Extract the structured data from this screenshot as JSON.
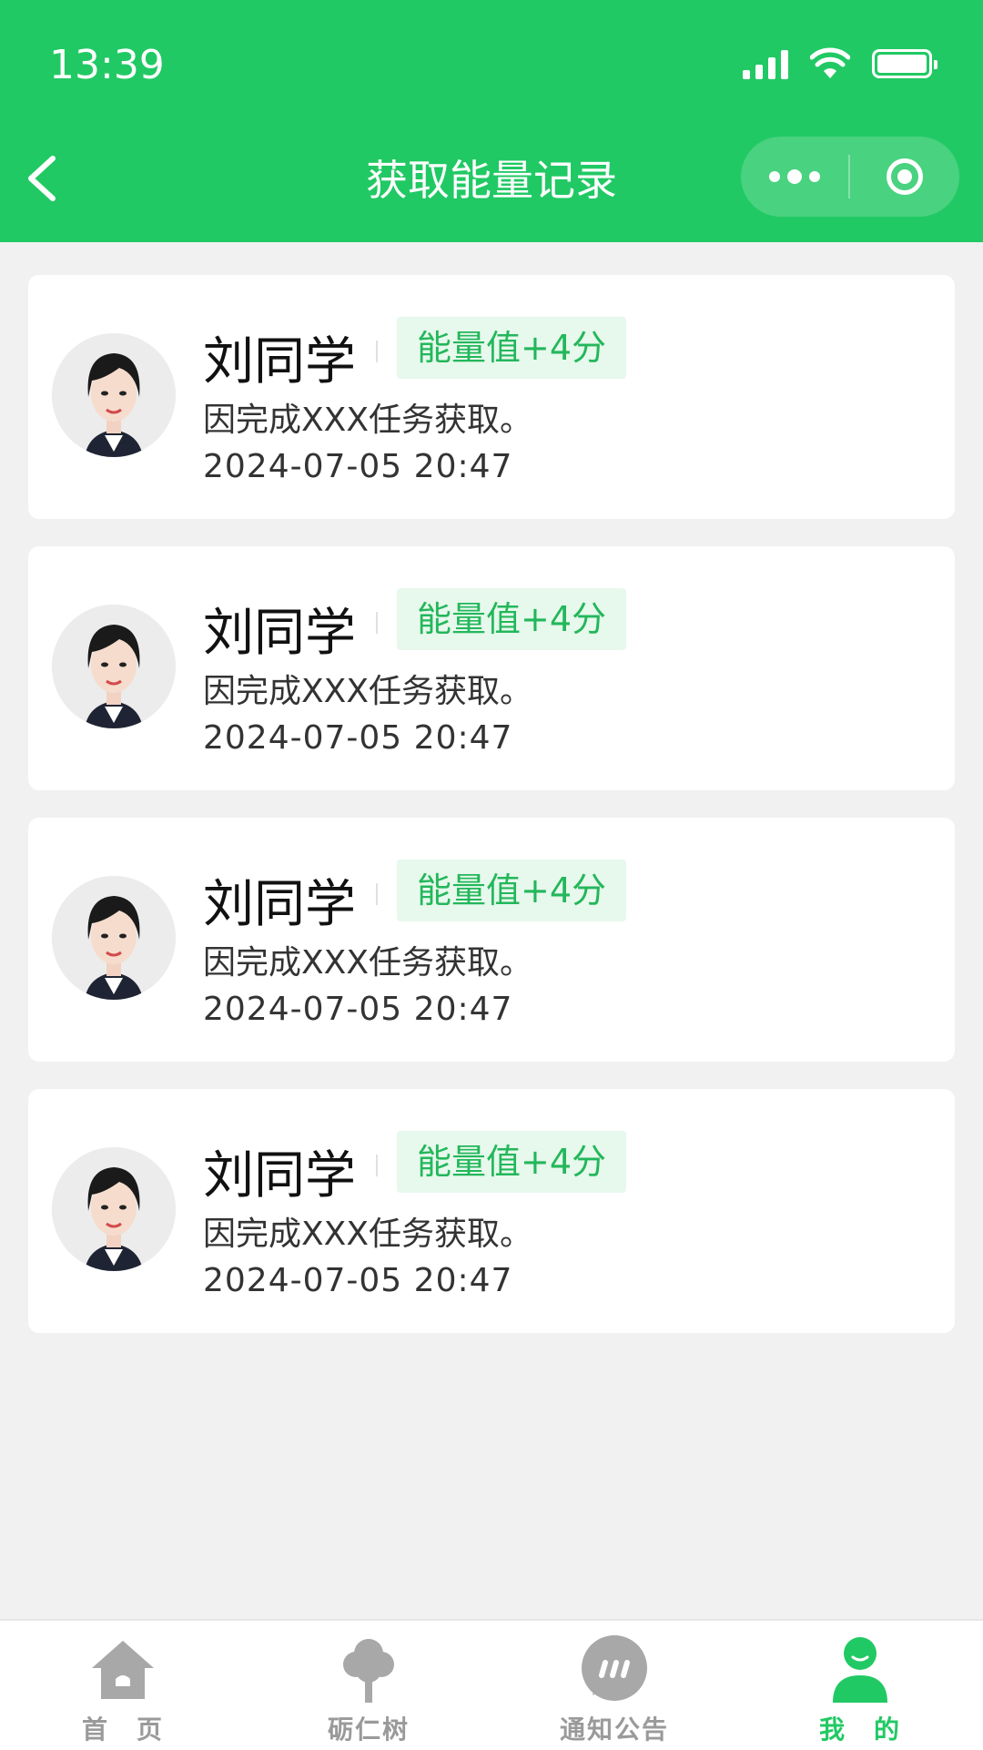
{
  "status_bar": {
    "time": "13:39"
  },
  "nav": {
    "title": "获取能量记录"
  },
  "records": [
    {
      "name": "刘同学",
      "badge": "能量值+4分",
      "description": "因完成XXX任务获取。",
      "datetime": "2024-07-05 20:47"
    },
    {
      "name": "刘同学",
      "badge": "能量值+4分",
      "description": "因完成XXX任务获取。",
      "datetime": "2024-07-05 20:47"
    },
    {
      "name": "刘同学",
      "badge": "能量值+4分",
      "description": "因完成XXX任务获取。",
      "datetime": "2024-07-05 20:47"
    },
    {
      "name": "刘同学",
      "badge": "能量值+4分",
      "description": "因完成XXX任务获取。",
      "datetime": "2024-07-05 20:47"
    }
  ],
  "tabbar": {
    "items": [
      {
        "label": "首　页",
        "icon": "home-icon"
      },
      {
        "label": "砺仁树",
        "icon": "tree-icon"
      },
      {
        "label": "通知公告",
        "icon": "chat-bubble-icon"
      },
      {
        "label": "我　的",
        "icon": "user-icon",
        "active": true
      }
    ]
  },
  "colors": {
    "brand": "#21c964",
    "badge_bg": "#e7f8ec",
    "badge_text": "#23b75b",
    "inactive": "#9a9a9a"
  }
}
